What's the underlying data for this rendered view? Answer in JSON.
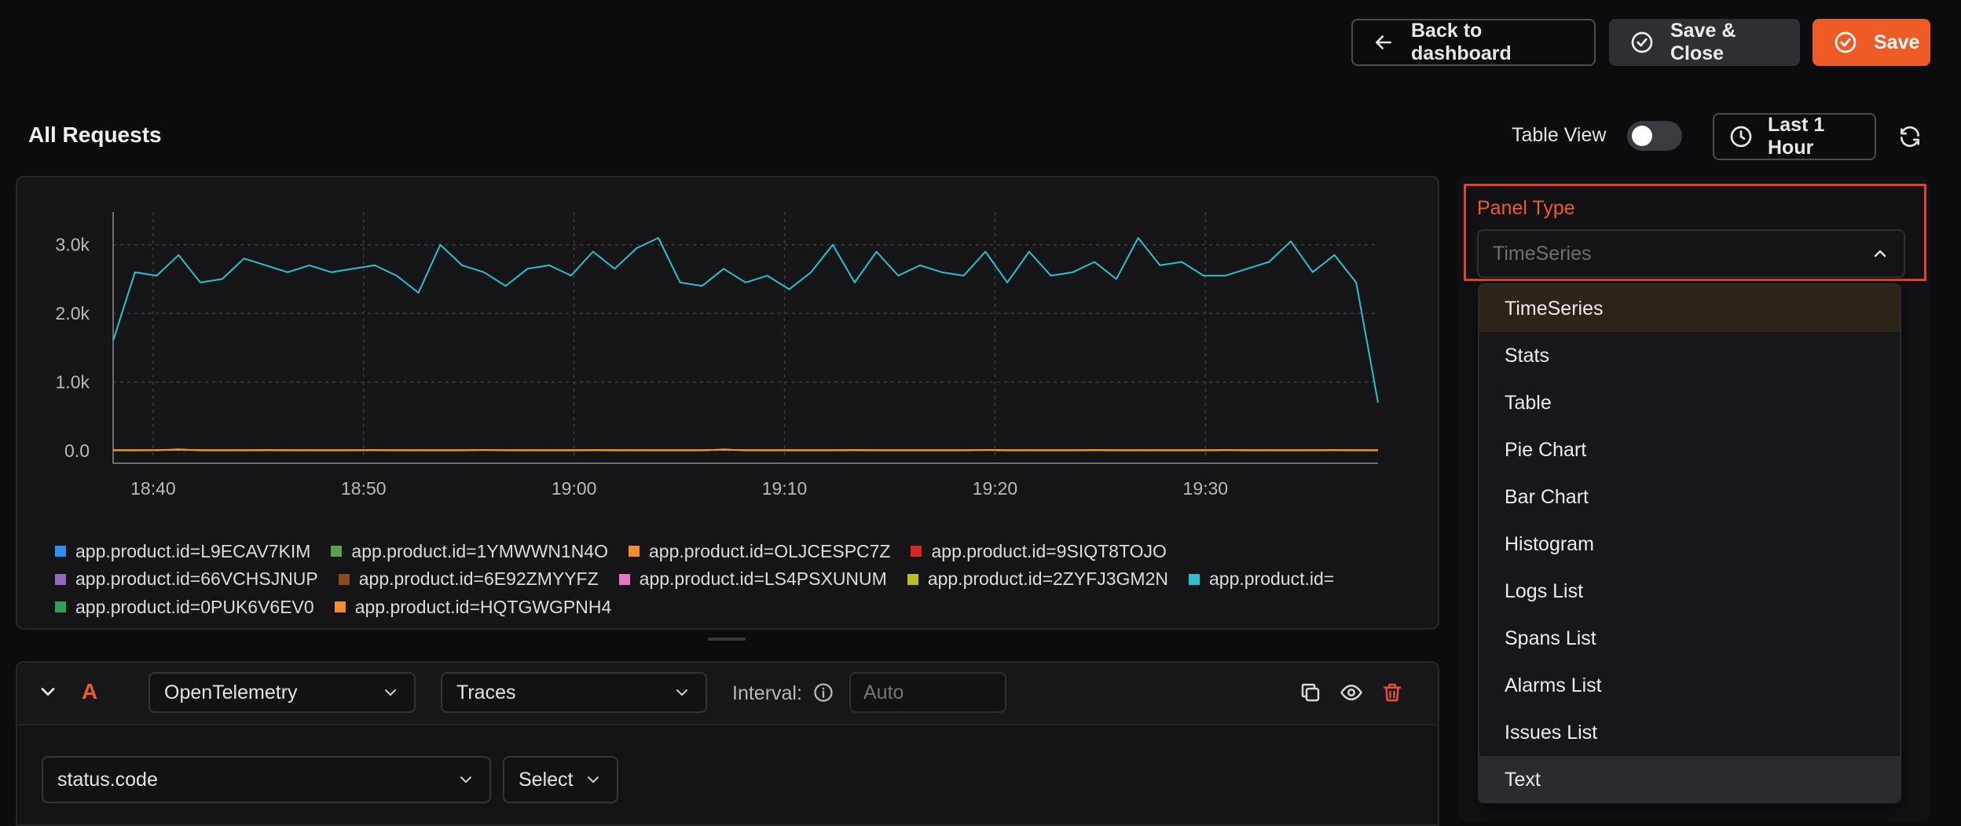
{
  "header": {
    "back_label": "Back to dashboard",
    "save_close_label": "Save & Close",
    "save_label": "Save"
  },
  "panel": {
    "title": "All Requests",
    "table_view_label": "Table View",
    "table_view_on": false,
    "time_range_label": "Last 1 Hour"
  },
  "chart_data": {
    "type": "line",
    "y_ticks": [
      "3.0k",
      "2.0k",
      "1.0k",
      "0.0"
    ],
    "ylim": [
      0,
      3500
    ],
    "x_ticks": [
      "18:40",
      "18:50",
      "19:00",
      "19:10",
      "19:20",
      "19:30"
    ],
    "xlim_minutes": [
      -1.9,
      58.2
    ],
    "grid": true,
    "legend_position": "bottom",
    "series": [
      {
        "name": "app.product.id=",
        "color": "#27c1cf",
        "values": [
          1600,
          2600,
          2550,
          2850,
          2450,
          2500,
          2800,
          2700,
          2600,
          2700,
          2600,
          2650,
          2700,
          2550,
          2300,
          3000,
          2700,
          2600,
          2400,
          2650,
          2700,
          2550,
          2900,
          2650,
          2950,
          3100,
          2450,
          2400,
          2650,
          2450,
          2550,
          2350,
          2600,
          3000,
          2450,
          2900,
          2550,
          2700,
          2600,
          2550,
          2900,
          2450,
          2900,
          2550,
          2600,
          2750,
          2500,
          3100,
          2700,
          2750,
          2550,
          2550,
          2650,
          2750,
          3050,
          2600,
          2850,
          2450,
          700
        ]
      },
      {
        "name": "app.product.id=HQTGWGPNH4",
        "color": "#f28e2b",
        "values": [
          10,
          10,
          10,
          12,
          10,
          10,
          10,
          11,
          10,
          10,
          10,
          10,
          11,
          10,
          10,
          10,
          10,
          12,
          10,
          10,
          10,
          10,
          11,
          10,
          10,
          10,
          10,
          10,
          12,
          10,
          10,
          10,
          10,
          10,
          11,
          10,
          10,
          10,
          10,
          10,
          12,
          10,
          10,
          10,
          10,
          11,
          10,
          10,
          10,
          10,
          10,
          12,
          10,
          10,
          10,
          10,
          11,
          10,
          10
        ]
      },
      {
        "name": "app.product.id=2ZYFJ3GM2N",
        "color": "#bcbd22",
        "values": [
          5,
          5,
          6,
          20,
          5,
          5,
          5,
          6,
          5,
          5,
          5,
          5,
          6,
          5,
          5,
          5,
          5,
          8,
          5,
          5,
          5,
          5,
          6,
          5,
          5,
          5,
          5,
          5,
          18,
          5,
          5,
          5,
          5,
          5,
          6,
          5,
          5,
          5,
          5,
          5,
          8,
          5,
          5,
          5,
          5,
          6,
          5,
          5,
          5,
          5,
          5,
          7,
          5,
          5,
          5,
          5,
          6,
          5,
          5
        ]
      }
    ],
    "legend": [
      {
        "label": "app.product.id=L9ECAV7KIM",
        "color": "#2f8ff0"
      },
      {
        "label": "app.product.id=1YMWWN1N4O",
        "color": "#59a14f"
      },
      {
        "label": "app.product.id=OLJCESPC7Z",
        "color": "#f28e2b"
      },
      {
        "label": "app.product.id=9SIQT8TOJO",
        "color": "#d62728"
      },
      {
        "label": "app.product.id=66VCHSJNUP",
        "color": "#9467bd"
      },
      {
        "label": "app.product.id=6E92ZMYYFZ",
        "color": "#8c4a1f"
      },
      {
        "label": "app.product.id=LS4PSXUNUM",
        "color": "#e377c2"
      },
      {
        "label": "app.product.id=2ZYFJ3GM2N",
        "color": "#bcbd22"
      },
      {
        "label": "app.product.id=",
        "color": "#27c1cf"
      },
      {
        "label": "app.product.id=0PUK6V6EV0",
        "color": "#2ca05a"
      },
      {
        "label": "app.product.id=HQTGWGPNH4",
        "color": "#f28e2b"
      }
    ]
  },
  "query": {
    "letter": "A",
    "source": "OpenTelemetry",
    "signal": "Traces",
    "interval_label": "Interval:",
    "interval_placeholder": "Auto",
    "group_by": "status.code",
    "aggregate": "Select"
  },
  "settings": {
    "panel_type_label": "Panel Type",
    "panel_type_value": "TimeSeries",
    "options": [
      "TimeSeries",
      "Stats",
      "Table",
      "Pie Chart",
      "Bar Chart",
      "Histogram",
      "Logs List",
      "Spans List",
      "Alarms List",
      "Issues List",
      "Text"
    ],
    "selected_index": 0,
    "hovered_index": 10
  },
  "colors": {
    "accent": "#ef5b24",
    "background": "#0c0c0f",
    "panel": "#151518"
  }
}
